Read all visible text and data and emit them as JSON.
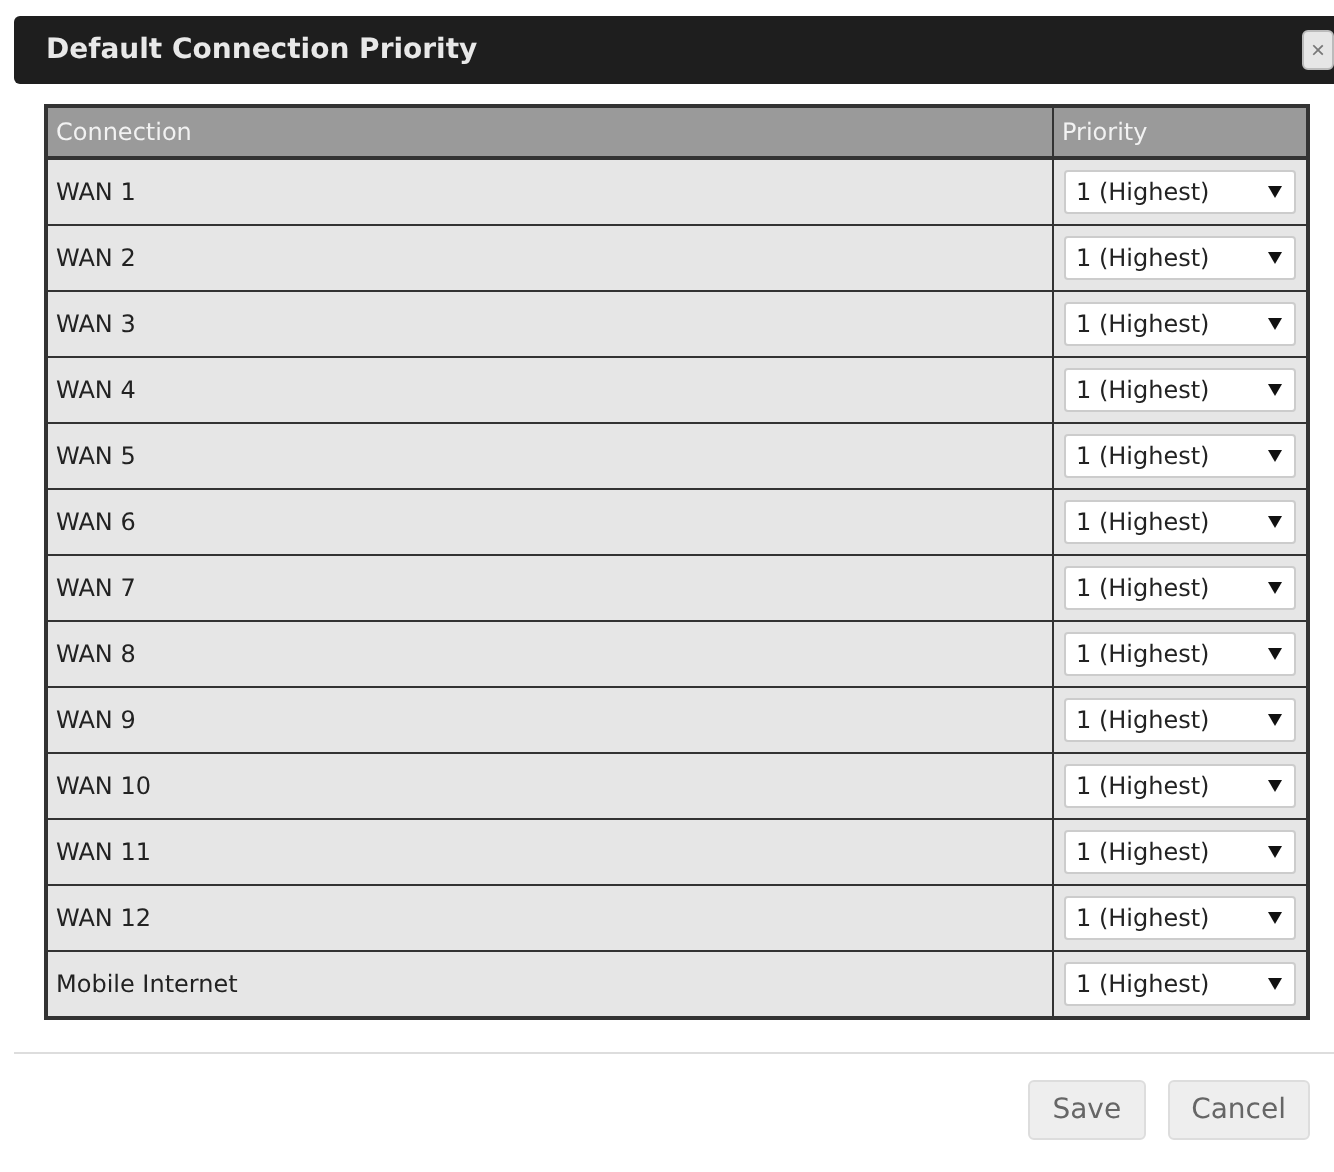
{
  "dialog": {
    "title": "Default Connection Priority",
    "close": "×"
  },
  "table": {
    "columns": [
      "Connection",
      "Priority"
    ],
    "rows": [
      {
        "connection": "WAN 1",
        "priority": "1 (Highest)"
      },
      {
        "connection": "WAN 2",
        "priority": "1 (Highest)"
      },
      {
        "connection": "WAN 3",
        "priority": "1 (Highest)"
      },
      {
        "connection": "WAN 4",
        "priority": "1 (Highest)"
      },
      {
        "connection": "WAN 5",
        "priority": "1 (Highest)"
      },
      {
        "connection": "WAN 6",
        "priority": "1 (Highest)"
      },
      {
        "connection": "WAN 7",
        "priority": "1 (Highest)"
      },
      {
        "connection": "WAN 8",
        "priority": "1 (Highest)"
      },
      {
        "connection": "WAN 9",
        "priority": "1 (Highest)"
      },
      {
        "connection": "WAN 10",
        "priority": "1 (Highest)"
      },
      {
        "connection": "WAN 11",
        "priority": "1 (Highest)"
      },
      {
        "connection": "WAN 12",
        "priority": "1 (Highest)"
      },
      {
        "connection": "Mobile Internet",
        "priority": "1 (Highest)"
      }
    ]
  },
  "buttons": [
    "Save",
    "Cancel"
  ]
}
